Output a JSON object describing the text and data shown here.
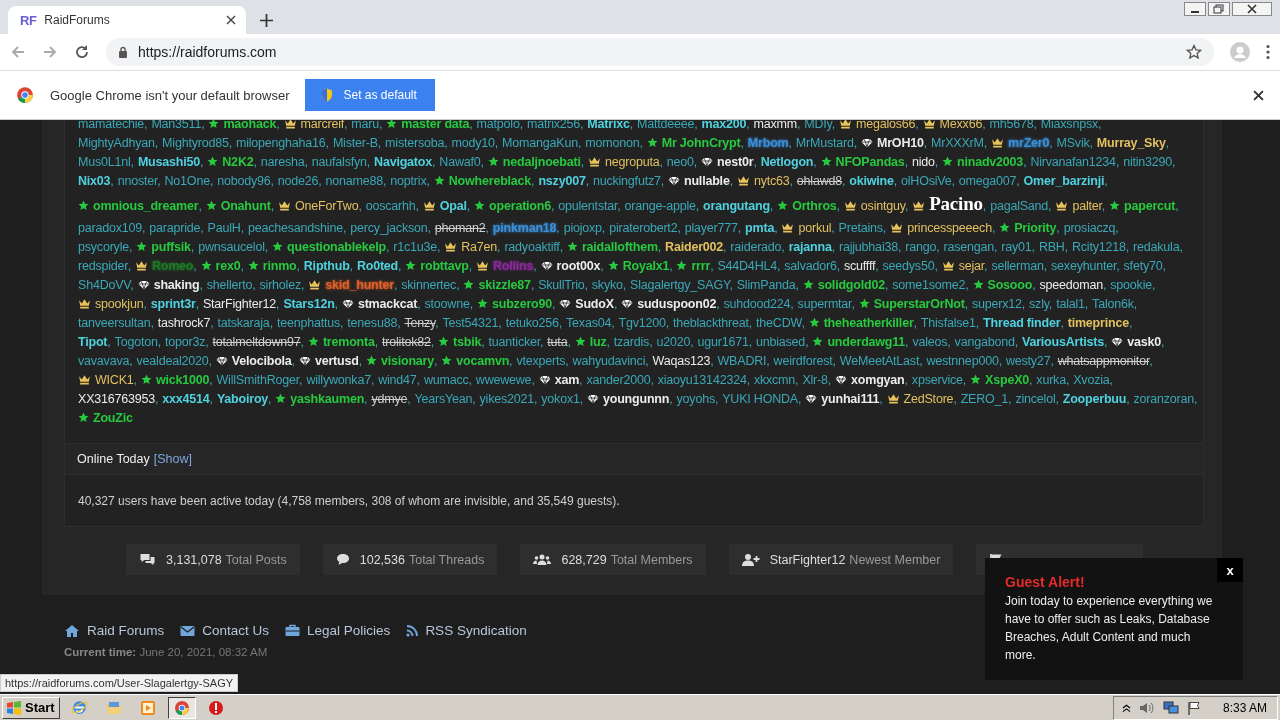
{
  "browser": {
    "tab_title": "RaidForums",
    "tab_logo": "RF",
    "url": "https://raidforums.com"
  },
  "infobar": {
    "message": "Google Chrome isn't your default browser",
    "button": "Set as default"
  },
  "users": {
    "separator": ",",
    "lines": [
      [
        {
          "name": "mamatechie",
          "kind": "member"
        },
        {
          "name": "Man3511",
          "kind": "member"
        },
        {
          "name": "maohack",
          "kind": "star"
        },
        {
          "name": "marcreif",
          "kind": "crown"
        },
        {
          "name": "maru",
          "kind": "member"
        },
        {
          "name": "master data",
          "kind": "star"
        },
        {
          "name": "matpolo",
          "kind": "member"
        },
        {
          "name": "matrix256",
          "kind": "member"
        },
        {
          "name": "Matrixc",
          "kind": "bold"
        },
        {
          "name": "Mattdeeee",
          "kind": "member"
        },
        {
          "name": "max200",
          "kind": "bold"
        },
        {
          "name": "maxmm",
          "kind": "white"
        },
        {
          "name": "MDIy",
          "kind": "member"
        },
        {
          "name": "megalos66",
          "kind": "crown"
        },
        {
          "name": "Mexx66",
          "kind": "crown"
        },
        {
          "name": "mh5678",
          "kind": "member"
        },
        {
          "name": "Miaxsnpsx",
          "kind": "member"
        }
      ],
      [
        {
          "name": "MightyAdhyan",
          "kind": "member"
        },
        {
          "name": "Mightyrod85",
          "kind": "member"
        },
        {
          "name": "milopenghaha16",
          "kind": "member"
        },
        {
          "name": "Mister-B",
          "kind": "member"
        },
        {
          "name": "mistersoba",
          "kind": "member"
        },
        {
          "name": "mody10",
          "kind": "member"
        },
        {
          "name": "MomangaKun",
          "kind": "member"
        },
        {
          "name": "momonon",
          "kind": "member"
        },
        {
          "name": "Mr JohnCrypt",
          "kind": "star"
        },
        {
          "name": "Mrbom",
          "kind": "glow",
          "color": "#3b8fd8"
        },
        {
          "name": "MrMustard",
          "kind": "member"
        },
        {
          "name": "MrOH10",
          "kind": "diamond"
        },
        {
          "name": "MrXXXrM",
          "kind": "member"
        },
        {
          "name": "mrZer0",
          "kind": "crown-glow",
          "color": "#3b8fd8"
        },
        {
          "name": "MSvik",
          "kind": "member"
        },
        {
          "name": "Murray_Sky",
          "kind": "gold"
        }
      ],
      [
        {
          "name": "Mus0L1nl",
          "kind": "member"
        },
        {
          "name": "Musashi50",
          "kind": "bold"
        },
        {
          "name": "N2K2",
          "kind": "star"
        },
        {
          "name": "naresha",
          "kind": "member"
        },
        {
          "name": "naufalsfyn",
          "kind": "member"
        },
        {
          "name": "Navigatox",
          "kind": "bold"
        },
        {
          "name": "Nawaf0",
          "kind": "member"
        },
        {
          "name": "nedaljnoebati",
          "kind": "star"
        },
        {
          "name": "negroputa",
          "kind": "crown"
        },
        {
          "name": "neo0",
          "kind": "member"
        },
        {
          "name": "nest0r",
          "kind": "diamond"
        },
        {
          "name": "Netlogon",
          "kind": "bold"
        },
        {
          "name": "NFOPandas",
          "kind": "star"
        },
        {
          "name": "nido",
          "kind": "white"
        },
        {
          "name": "ninadv2003",
          "kind": "star"
        },
        {
          "name": "Nirvanafan1234",
          "kind": "member"
        },
        {
          "name": "nitin3290",
          "kind": "member"
        }
      ],
      [
        {
          "name": "Nix03",
          "kind": "bold"
        },
        {
          "name": "nnoster",
          "kind": "member"
        },
        {
          "name": "No1One",
          "kind": "member"
        },
        {
          "name": "nobody96",
          "kind": "member"
        },
        {
          "name": "node26",
          "kind": "member"
        },
        {
          "name": "noname88",
          "kind": "member"
        },
        {
          "name": "noptrix",
          "kind": "member"
        },
        {
          "name": "Nowhereblack",
          "kind": "star"
        },
        {
          "name": "nszy007",
          "kind": "bold"
        },
        {
          "name": "nuckingfutz7",
          "kind": "member"
        },
        {
          "name": "nullable",
          "kind": "diamond"
        },
        {
          "name": "nytc63",
          "kind": "crown"
        },
        {
          "name": "ohlawd8",
          "kind": "banned"
        },
        {
          "name": "okiwine",
          "kind": "bold"
        },
        {
          "name": "olHOsiVe",
          "kind": "member"
        },
        {
          "name": "omega007",
          "kind": "member"
        },
        {
          "name": "Omer_barzinji",
          "kind": "bold"
        }
      ],
      [
        {
          "name": "omnious_dreamer",
          "kind": "star"
        },
        {
          "name": "Onahunt",
          "kind": "star"
        },
        {
          "name": "OneForTwo",
          "kind": "crown"
        },
        {
          "name": "ooscarhh",
          "kind": "member"
        },
        {
          "name": "Opal",
          "kind": "crown-bold"
        },
        {
          "name": "operation6",
          "kind": "star"
        },
        {
          "name": "opulentstar",
          "kind": "member"
        },
        {
          "name": "orange-apple",
          "kind": "member"
        },
        {
          "name": "orangutang",
          "kind": "bold"
        },
        {
          "name": "Orthros",
          "kind": "star"
        },
        {
          "name": "osintguy",
          "kind": "crown"
        },
        {
          "name": "Pacino",
          "kind": "fancy"
        },
        {
          "name": "pagalSand",
          "kind": "member"
        },
        {
          "name": "palter",
          "kind": "crown"
        },
        {
          "name": "papercut",
          "kind": "star"
        }
      ],
      [
        {
          "name": "paradox109",
          "kind": "member"
        },
        {
          "name": "parapride",
          "kind": "member"
        },
        {
          "name": "PaulH",
          "kind": "member"
        },
        {
          "name": "peachesandshine",
          "kind": "member"
        },
        {
          "name": "percy_jackson",
          "kind": "member"
        },
        {
          "name": "phoman2",
          "kind": "banned"
        },
        {
          "name": "pinkman18",
          "kind": "glow",
          "color": "#3b8fd8"
        },
        {
          "name": "piojoxp",
          "kind": "member"
        },
        {
          "name": "piraterobert2",
          "kind": "member"
        },
        {
          "name": "player777",
          "kind": "member"
        },
        {
          "name": "pmta",
          "kind": "bold"
        },
        {
          "name": "porkul",
          "kind": "crown"
        },
        {
          "name": "Pretains",
          "kind": "member"
        },
        {
          "name": "princesspeeech",
          "kind": "crown"
        },
        {
          "name": "Priority",
          "kind": "star"
        },
        {
          "name": "prosiaczq",
          "kind": "member"
        }
      ],
      [
        {
          "name": "psycoryle",
          "kind": "member"
        },
        {
          "name": "puffsik",
          "kind": "star"
        },
        {
          "name": "pwnsaucelol",
          "kind": "member"
        },
        {
          "name": "questionablekelp",
          "kind": "star"
        },
        {
          "name": "r1c1u3e",
          "kind": "member"
        },
        {
          "name": "Ra7en",
          "kind": "crown"
        },
        {
          "name": "radyoaktiff",
          "kind": "member"
        },
        {
          "name": "raidallofthem",
          "kind": "star"
        },
        {
          "name": "Raider002",
          "kind": "gold"
        },
        {
          "name": "raiderado",
          "kind": "member"
        },
        {
          "name": "rajanna",
          "kind": "bold"
        },
        {
          "name": "rajjubhai38",
          "kind": "member"
        },
        {
          "name": "rango",
          "kind": "member"
        },
        {
          "name": "rasengan",
          "kind": "member"
        },
        {
          "name": "ray01",
          "kind": "member"
        },
        {
          "name": "RBH",
          "kind": "member"
        },
        {
          "name": "Rcity1218",
          "kind": "member"
        },
        {
          "name": "redakula",
          "kind": "member"
        }
      ],
      [
        {
          "name": "redspider",
          "kind": "member"
        },
        {
          "name": "Romeo",
          "kind": "crown-glow",
          "color": "#1e7a25"
        },
        {
          "name": "rex0",
          "kind": "star"
        },
        {
          "name": "rinmo",
          "kind": "star"
        },
        {
          "name": "Ripthub",
          "kind": "bold"
        },
        {
          "name": "Ro0ted",
          "kind": "bold"
        },
        {
          "name": "robttavp",
          "kind": "star"
        },
        {
          "name": "Rollins",
          "kind": "crown-glow",
          "color": "#8a2a9a"
        },
        {
          "name": "root00x",
          "kind": "diamond"
        },
        {
          "name": "Royalx1",
          "kind": "star"
        },
        {
          "name": "rrrr",
          "kind": "star"
        },
        {
          "name": "S44D4HL4",
          "kind": "member"
        },
        {
          "name": "salvador6",
          "kind": "member"
        },
        {
          "name": "scuffff",
          "kind": "white"
        },
        {
          "name": "seedys50",
          "kind": "member"
        },
        {
          "name": "sejar",
          "kind": "crown"
        },
        {
          "name": "sellerman",
          "kind": "member"
        },
        {
          "name": "sexeyhunter",
          "kind": "member"
        },
        {
          "name": "sfety70",
          "kind": "member"
        }
      ],
      [
        {
          "name": "Sh4DoVV",
          "kind": "member"
        },
        {
          "name": "shaking",
          "kind": "diamond"
        },
        {
          "name": "shellerto",
          "kind": "member"
        },
        {
          "name": "sirholez",
          "kind": "member"
        },
        {
          "name": "skid_hunter",
          "kind": "crown-glow",
          "color": "#e0602a"
        },
        {
          "name": "skinnertec",
          "kind": "member"
        },
        {
          "name": "skizzle87",
          "kind": "star"
        },
        {
          "name": "SkullTrio",
          "kind": "member"
        },
        {
          "name": "skyko",
          "kind": "member"
        },
        {
          "name": "Slagalertgy_SAGY",
          "kind": "member"
        },
        {
          "name": "SlimPanda",
          "kind": "member"
        },
        {
          "name": "solidgold02",
          "kind": "star"
        },
        {
          "name": "some1some2",
          "kind": "member"
        },
        {
          "name": "Sosooo",
          "kind": "star"
        },
        {
          "name": "speedoman",
          "kind": "white"
        },
        {
          "name": "spookie",
          "kind": "member"
        }
      ],
      [
        {
          "name": "spookjun",
          "kind": "crown"
        },
        {
          "name": "sprint3r",
          "kind": "bold"
        },
        {
          "name": "StarFighter12",
          "kind": "white"
        },
        {
          "name": "Stars12n",
          "kind": "bold"
        },
        {
          "name": "stmackcat",
          "kind": "diamond"
        },
        {
          "name": "stoowne",
          "kind": "member"
        },
        {
          "name": "subzero90",
          "kind": "star"
        },
        {
          "name": "SudoX",
          "kind": "diamond"
        },
        {
          "name": "suduspoon02",
          "kind": "diamond"
        },
        {
          "name": "suhdood224",
          "kind": "member"
        },
        {
          "name": "supermtar",
          "kind": "member"
        },
        {
          "name": "SuperstarOrNot",
          "kind": "star"
        },
        {
          "name": "superx12",
          "kind": "member"
        },
        {
          "name": "szly",
          "kind": "member"
        },
        {
          "name": "talal1",
          "kind": "member"
        },
        {
          "name": "Talon6k",
          "kind": "member"
        }
      ],
      [
        {
          "name": "tanveersultan",
          "kind": "member"
        },
        {
          "name": "tashrock7",
          "kind": "white"
        },
        {
          "name": "tatskaraja",
          "kind": "member"
        },
        {
          "name": "teenphattus",
          "kind": "member"
        },
        {
          "name": "tenesu88",
          "kind": "member"
        },
        {
          "name": "Tenzy",
          "kind": "banned"
        },
        {
          "name": "Test54321",
          "kind": "member"
        },
        {
          "name": "tetuko256",
          "kind": "member"
        },
        {
          "name": "Texas04",
          "kind": "member"
        },
        {
          "name": "Tgv1200",
          "kind": "member"
        },
        {
          "name": "theblackthreat",
          "kind": "member"
        },
        {
          "name": "theCDW",
          "kind": "member"
        },
        {
          "name": "theheatherkiller",
          "kind": "star"
        },
        {
          "name": "Thisfalse1",
          "kind": "member"
        },
        {
          "name": "Thread finder",
          "kind": "bold"
        },
        {
          "name": "timeprince",
          "kind": "gold"
        }
      ],
      [
        {
          "name": "Tipot",
          "kind": "bold"
        },
        {
          "name": "Togoton",
          "kind": "member"
        },
        {
          "name": "topor3z",
          "kind": "member"
        },
        {
          "name": "totalmeltdown97",
          "kind": "banned"
        },
        {
          "name": "tremonta",
          "kind": "star"
        },
        {
          "name": "trolitok82",
          "kind": "banned"
        },
        {
          "name": "tsbik",
          "kind": "star"
        },
        {
          "name": "tuanticker",
          "kind": "member"
        },
        {
          "name": "tuta",
          "kind": "banned"
        },
        {
          "name": "luz",
          "kind": "star"
        },
        {
          "name": "tzardis",
          "kind": "member"
        },
        {
          "name": "u2020",
          "kind": "member"
        },
        {
          "name": "ugur1671",
          "kind": "member"
        },
        {
          "name": "unbiased",
          "kind": "member"
        },
        {
          "name": "underdawg11",
          "kind": "star"
        },
        {
          "name": "valeos",
          "kind": "member"
        },
        {
          "name": "vangabond",
          "kind": "member"
        },
        {
          "name": "VariousArtists",
          "kind": "bold"
        },
        {
          "name": "vask0",
          "kind": "diamond"
        }
      ],
      [
        {
          "name": "vavavava",
          "kind": "member"
        },
        {
          "name": "vealdeal2020",
          "kind": "member"
        },
        {
          "name": "Velocibola",
          "kind": "diamond"
        },
        {
          "name": "vertusd",
          "kind": "diamond"
        },
        {
          "name": "visionary",
          "kind": "star"
        },
        {
          "name": "vocamvn",
          "kind": "star"
        },
        {
          "name": "vtexperts",
          "kind": "member"
        },
        {
          "name": "wahyudavinci",
          "kind": "member"
        },
        {
          "name": "Waqas123",
          "kind": "white"
        },
        {
          "name": "WBADRI",
          "kind": "member"
        },
        {
          "name": "weirdforest",
          "kind": "member"
        },
        {
          "name": "WeMeetAtLast",
          "kind": "member"
        },
        {
          "name": "westnnep000",
          "kind": "member"
        },
        {
          "name": "westy27",
          "kind": "member"
        },
        {
          "name": "whatsappmonitor",
          "kind": "banned"
        }
      ],
      [
        {
          "name": "WICK1",
          "kind": "crown"
        },
        {
          "name": "wick1000",
          "kind": "star"
        },
        {
          "name": "WillSmithRoger",
          "kind": "member"
        },
        {
          "name": "willywonka7",
          "kind": "member"
        },
        {
          "name": "wind47",
          "kind": "member"
        },
        {
          "name": "wumacc",
          "kind": "member"
        },
        {
          "name": "wwewewe",
          "kind": "member"
        },
        {
          "name": "xam",
          "kind": "diamond"
        },
        {
          "name": "xander2000",
          "kind": "member"
        },
        {
          "name": "xiaoyu13142324",
          "kind": "member"
        },
        {
          "name": "xkxcmn",
          "kind": "member"
        },
        {
          "name": "Xlr-8",
          "kind": "member"
        },
        {
          "name": "xomgyan",
          "kind": "diamond"
        },
        {
          "name": "xpservice",
          "kind": "member"
        },
        {
          "name": "XspeX0",
          "kind": "star"
        },
        {
          "name": "xurka",
          "kind": "member"
        },
        {
          "name": "Xvozia",
          "kind": "member"
        }
      ],
      [
        {
          "name": "XX316763953",
          "kind": "white"
        },
        {
          "name": "xxx4514",
          "kind": "bold"
        },
        {
          "name": "Yaboiroy",
          "kind": "bold"
        },
        {
          "name": "yashkaumen",
          "kind": "star"
        },
        {
          "name": "ydmye",
          "kind": "banned"
        },
        {
          "name": "YearsYean",
          "kind": "member"
        },
        {
          "name": "yikes2021",
          "kind": "member"
        },
        {
          "name": "yokox1",
          "kind": "member"
        },
        {
          "name": "youngunnn",
          "kind": "diamond"
        },
        {
          "name": "yoyohs",
          "kind": "member"
        },
        {
          "name": "YUKI HONDA",
          "kind": "member"
        },
        {
          "name": "yunhai111",
          "kind": "diamond"
        },
        {
          "name": "ZedStore",
          "kind": "crown"
        },
        {
          "name": "ZERO_1",
          "kind": "member"
        },
        {
          "name": "zincelol",
          "kind": "member"
        },
        {
          "name": "Zooperbuu",
          "kind": "bold"
        },
        {
          "name": "zoranzoran",
          "kind": "member"
        }
      ],
      [
        {
          "name": "ZouZic",
          "kind": "star"
        }
      ]
    ]
  },
  "online_today": {
    "title": "Online Today",
    "link": "[Show]",
    "summary": "40,327 users have been active today (4,758 members, 308 of whom are invisible, and 35,549 guests)."
  },
  "stats": [
    {
      "value": "3,131,078",
      "label": "Total Posts"
    },
    {
      "value": "102,536",
      "label": "Total Threads"
    },
    {
      "value": "628,729",
      "label": "Total Members"
    },
    {
      "value": "StarFighter12",
      "label": "Newest Member"
    }
  ],
  "footer": {
    "links": [
      "Raid Forums",
      "Contact Us",
      "Legal Policies",
      "RSS Syndication"
    ],
    "current_time_label": "Current time:",
    "current_time": "June 20, 2021, 08:32 AM"
  },
  "status_url": "https://raidforums.com/User-Slagalertgy-SAGY",
  "guest_alert": {
    "close": "x",
    "title": "Guest Alert!",
    "body": "Join today to experience everything we have to offer such as Leaks, Database Breaches, Adult Content and much more."
  },
  "taskbar": {
    "start": "Start",
    "apps": [
      {
        "selected": false
      },
      {
        "selected": false
      },
      {
        "selected": false
      },
      {
        "selected": true
      },
      {
        "selected": false
      }
    ],
    "clock": "8:33 AM"
  }
}
